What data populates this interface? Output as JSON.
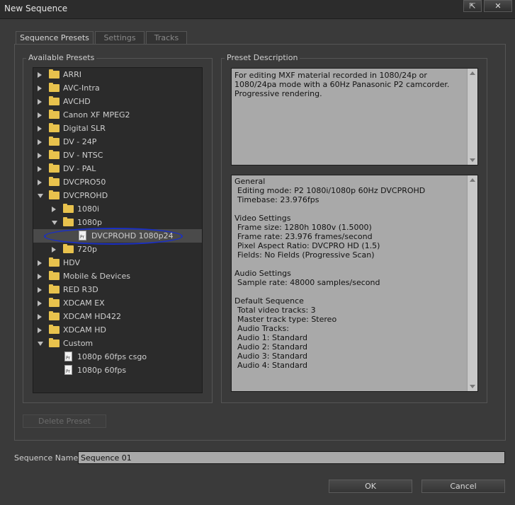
{
  "window": {
    "title": "New Sequence"
  },
  "tabs": [
    {
      "label": "Sequence Presets"
    },
    {
      "label": "Settings"
    },
    {
      "label": "Tracks"
    }
  ],
  "presets": {
    "group_label": "Available Presets",
    "items": [
      {
        "label": "ARRI",
        "level": 0,
        "type": "folder",
        "expanded": false
      },
      {
        "label": "AVC-Intra",
        "level": 0,
        "type": "folder",
        "expanded": false
      },
      {
        "label": "AVCHD",
        "level": 0,
        "type": "folder",
        "expanded": false
      },
      {
        "label": "Canon XF MPEG2",
        "level": 0,
        "type": "folder",
        "expanded": false
      },
      {
        "label": "Digital SLR",
        "level": 0,
        "type": "folder",
        "expanded": false
      },
      {
        "label": "DV - 24P",
        "level": 0,
        "type": "folder",
        "expanded": false
      },
      {
        "label": "DV - NTSC",
        "level": 0,
        "type": "folder",
        "expanded": false
      },
      {
        "label": "DV - PAL",
        "level": 0,
        "type": "folder",
        "expanded": false
      },
      {
        "label": "DVCPRO50",
        "level": 0,
        "type": "folder",
        "expanded": false
      },
      {
        "label": "DVCPROHD",
        "level": 0,
        "type": "folder",
        "expanded": true
      },
      {
        "label": "1080i",
        "level": 1,
        "type": "folder",
        "expanded": false
      },
      {
        "label": "1080p",
        "level": 1,
        "type": "folder",
        "expanded": true
      },
      {
        "label": "DVCPROHD 1080p24",
        "level": 2,
        "type": "file",
        "selected": true
      },
      {
        "label": "720p",
        "level": 1,
        "type": "folder",
        "expanded": false
      },
      {
        "label": "HDV",
        "level": 0,
        "type": "folder",
        "expanded": false
      },
      {
        "label": "Mobile & Devices",
        "level": 0,
        "type": "folder",
        "expanded": false
      },
      {
        "label": "RED R3D",
        "level": 0,
        "type": "folder",
        "expanded": false
      },
      {
        "label": "XDCAM EX",
        "level": 0,
        "type": "folder",
        "expanded": false
      },
      {
        "label": "XDCAM HD422",
        "level": 0,
        "type": "folder",
        "expanded": false
      },
      {
        "label": "XDCAM HD",
        "level": 0,
        "type": "folder",
        "expanded": false
      },
      {
        "label": "Custom",
        "level": 0,
        "type": "folder",
        "expanded": true
      },
      {
        "label": "1080p 60fps csgo",
        "level": 1,
        "type": "file"
      },
      {
        "label": "1080p 60fps",
        "level": 1,
        "type": "file"
      }
    ],
    "file_icon_text": "Pr"
  },
  "description": {
    "group_label": "Preset Description",
    "text": "For editing MXF material recorded in 1080/24p or 1080/24pa mode with a 60Hz Panasonic P2 camcorder.  Progressive rendering."
  },
  "details": {
    "lines": [
      "General",
      " Editing mode: P2 1080i/1080p 60Hz DVCPROHD",
      " Timebase: 23.976fps",
      "",
      "Video Settings",
      " Frame size: 1280h 1080v (1.5000)",
      " Frame rate: 23.976 frames/second",
      " Pixel Aspect Ratio: DVCPRO HD (1.5)",
      " Fields: No Fields (Progressive Scan)",
      "",
      "Audio Settings",
      " Sample rate: 48000 samples/second",
      "",
      "Default Sequence",
      " Total video tracks: 3",
      " Master track type: Stereo",
      " Audio Tracks:",
      " Audio 1: Standard",
      " Audio 2: Standard",
      " Audio 3: Standard",
      " Audio 4: Standard"
    ]
  },
  "buttons": {
    "delete_preset": "Delete Preset",
    "ok": "OK",
    "cancel": "Cancel"
  },
  "sequence_name": {
    "label": "Sequence Name:",
    "value": "Sequence 01"
  },
  "colors": {
    "annotation": "#1a2fc4",
    "folder": "#e8c24d"
  }
}
